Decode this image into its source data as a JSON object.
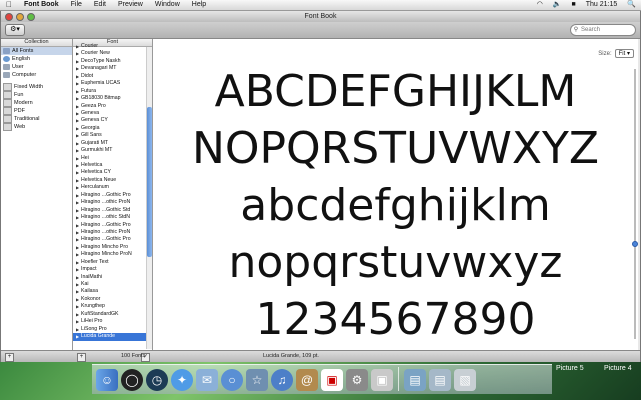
{
  "menubar": {
    "app": "Font Book",
    "items": [
      "File",
      "Edit",
      "Preview",
      "Window",
      "Help"
    ],
    "clock": "Thu 21:15"
  },
  "window": {
    "title": "Font Book",
    "search_placeholder": "Search"
  },
  "collection": {
    "header": "Collection",
    "items": [
      {
        "label": "All Fonts",
        "selected": true
      },
      {
        "label": "English",
        "selected": false
      },
      {
        "label": "User",
        "selected": false
      },
      {
        "label": "Computer",
        "selected": false
      }
    ],
    "groups": [
      "Fixed Width",
      "Fun",
      "Modern",
      "PDF",
      "Traditional",
      "Web"
    ]
  },
  "fonts": {
    "header": "Font",
    "items": [
      "Courier",
      "Courier New",
      "DecoType Naskh",
      "Devanagari MT",
      "Didot",
      "Euphemia UCAS",
      "Futura",
      "GB18030 Bitmap",
      "Geeza Pro",
      "Geneva",
      "Geneva CY",
      "Georgia",
      "Gill Sans",
      "Gujarati MT",
      "Gurmukhi MT",
      "Hei",
      "Helvetica",
      "Helvetica CY",
      "Helvetica Neue",
      "Herculanum",
      "Hiragino ...Gothic Pro",
      "Hiragino ...othic ProN",
      "Hiragino ...Gothic Std",
      "Hiragino ...othic StdN",
      "Hiragino ...Gothic Pro",
      "Hiragino ...othic ProN",
      "Hiragino ...Gothic Pro",
      "Hiragino Mincho Pro",
      "Hiragino Mincho ProN",
      "Hoefler Text",
      "Impact",
      "InaiMathi",
      "Kai",
      "Kailasa",
      "Kokonor",
      "Krungthep",
      "KufiStandardGK",
      "LiHei Pro",
      "LiSong Pro",
      "Lucida Grande"
    ],
    "selected": "Lucida Grande"
  },
  "preview": {
    "size_label": "Size:",
    "size_value": "Fit",
    "lines": [
      "ABCDEFGHIJKLM",
      "NOPQRSTUVWXYZ",
      "abcdefghijklm",
      "nopqrstuvwxyz",
      "1234567890"
    ]
  },
  "statusbar": {
    "count": "100 Fonts",
    "status": "Lucida Grande, 109 pt."
  },
  "desktop": {
    "pictures": [
      "Picture 5",
      "Picture 4"
    ]
  }
}
